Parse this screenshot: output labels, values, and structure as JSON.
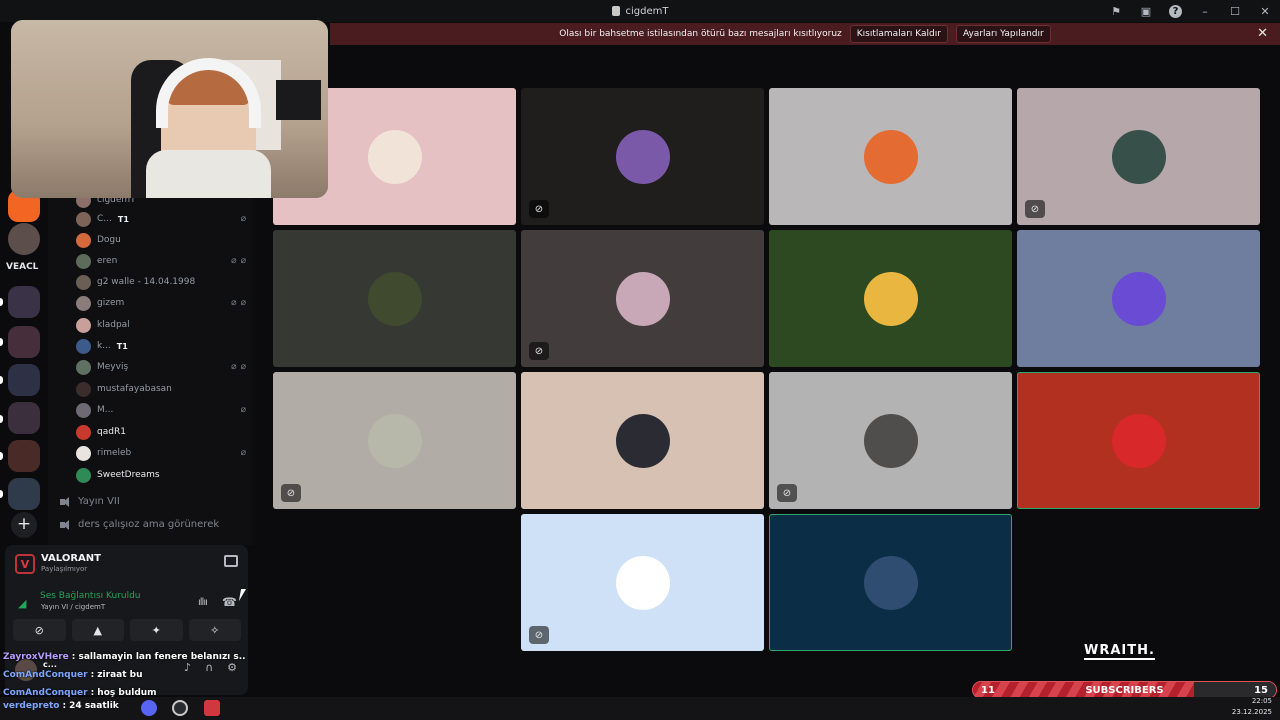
{
  "titlebar": {
    "title": "cigdemT"
  },
  "banner": {
    "message": "Olası bir bahsetme istilasından ötürü bazı mesajları kısıtlıyoruz",
    "btn_remove": "Kısıtlamaları Kaldır",
    "btn_settings": "Ayarları Yapılandır"
  },
  "rail": {
    "label": "VEACL"
  },
  "voice_users": [
    {
      "name": "cigdemT",
      "badge": ""
    },
    {
      "name": "C...",
      "badge": "T1"
    },
    {
      "name": "Dogu",
      "badge": ""
    },
    {
      "name": "eren",
      "badge": ""
    },
    {
      "name": "g2 walle - 14.04.1998",
      "badge": ""
    },
    {
      "name": "gizem",
      "badge": ""
    },
    {
      "name": "kladpal",
      "badge": ""
    },
    {
      "name": "k...",
      "badge": "T1"
    },
    {
      "name": "Meyviş",
      "badge": ""
    },
    {
      "name": "mustafayabasan",
      "badge": ""
    },
    {
      "name": "M...",
      "badge": ""
    },
    {
      "name": "qadR1",
      "badge": ""
    },
    {
      "name": "rimeleb",
      "badge": ""
    },
    {
      "name": "SweetDreams",
      "badge": ""
    }
  ],
  "channels": [
    {
      "name": "Yayın VII"
    },
    {
      "name": "ders çalışıoz ama görünerek"
    }
  ],
  "panel": {
    "game_name": "VALORANT",
    "game_status": "Paylaşılmıyor",
    "connection_title": "Ses Bağlantısı Kuruldu",
    "connection_sub": "Yayın VI / cigdemT",
    "user_name": "c..."
  },
  "chat": [
    {
      "user": "ZayroxVHere",
      "text": ": sallamayin lan fenere belanızı s.."
    },
    {
      "user": "ComAndConquer",
      "text": ": ziraat bu"
    },
    {
      "user": "ComAndConquer",
      "text": ": hoş buldum"
    },
    {
      "user": "verdepreto",
      "text": ": 24 saatlik"
    }
  ],
  "overlay": {
    "brand": "WRAITH.",
    "subs_label": "SUBSCRIBERS",
    "subs_current": "11",
    "subs_goal": "15",
    "subs_progress": 0.73
  },
  "clock": {
    "time": "22:05",
    "date": "23.12.2025"
  },
  "tiles": [
    {
      "bg": "#e6c1c4",
      "av": "#f1e3d8",
      "muted": false
    },
    {
      "bg": "#1f1e1d",
      "av": "#7a5aa8",
      "muted": true
    },
    {
      "bg": "#b9b7b8",
      "av": "#e46b32",
      "muted": false
    },
    {
      "bg": "#b5a7aa",
      "av": "#38504a",
      "muted": true
    },
    {
      "bg": "#363833",
      "av": "#3f4a2f",
      "muted": false
    },
    {
      "bg": "#423d3c",
      "av": "#c8a8b6",
      "muted": true
    },
    {
      "bg": "#2d4921",
      "av": "#e9b640",
      "muted": false
    },
    {
      "bg": "#6f7d9e",
      "av": "#6a4bd4",
      "muted": false
    },
    {
      "bg": "#b1aca6",
      "av": "#b7b8a9",
      "muted": true
    },
    {
      "bg": "#d6c1b3",
      "av": "#2b2b33",
      "muted": false
    },
    {
      "bg": "#b4b3b3",
      "av": "#4f4e4c",
      "muted": true
    },
    {
      "bg": "#b2301f",
      "av": "#d8282a",
      "muted": false,
      "speaking": true
    },
    {
      "bg": "#cfe1f6",
      "av": "#ffffff",
      "muted": true
    },
    {
      "bg": "#0c2d46",
      "av": "#2f4d70",
      "muted": false,
      "speaking": true
    }
  ]
}
